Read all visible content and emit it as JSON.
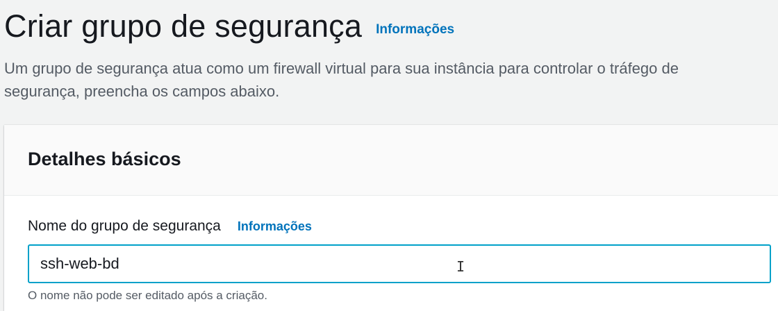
{
  "header": {
    "title": "Criar grupo de segurança",
    "info_link": "Informações",
    "description_line1": "Um grupo de segurança atua como um firewall virtual para sua instância para controlar o tráfego de",
    "description_line2": "segurança, preencha os campos abaixo."
  },
  "basic_details": {
    "title": "Detalhes básicos",
    "name_field": {
      "label": "Nome do grupo de segurança",
      "info_link": "Informações",
      "value": "ssh-web-bd",
      "constraint": "O nome não pode ser editado após a criação."
    }
  },
  "colors": {
    "link": "#0073bb",
    "focus_border": "#00a1c9",
    "background": "#f2f3f3"
  },
  "icons": {
    "text_cursor": "i-beam-cursor-icon"
  }
}
